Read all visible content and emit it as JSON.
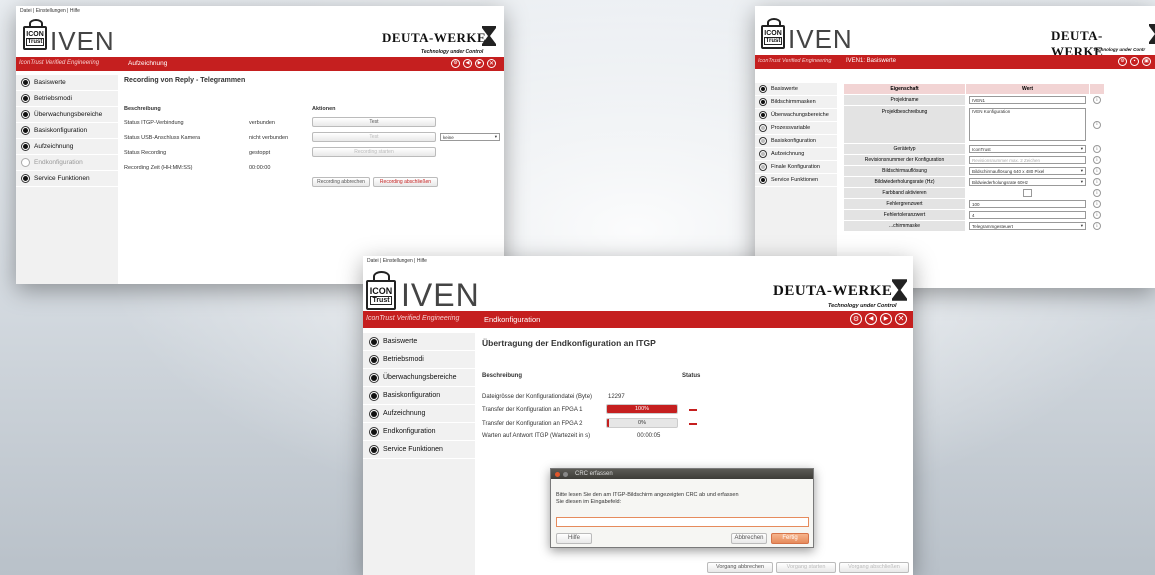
{
  "left_window": {
    "menubar": "Datei | Einstellungen | Hilfe",
    "logo_icon": "ICON",
    "logo_trust": "Trust",
    "logo_iven": "IVEN",
    "brand": "DEUTA-WERKE",
    "brand_tag": "Technology under Control",
    "tagline": "IconTrust Verified Engineering",
    "page_title": "Aufzeichnung",
    "sidebar": [
      "Basiswerte",
      "Betriebsmodi",
      "Überwachungsbereiche",
      "Basiskonfiguration",
      "Aufzeichnung",
      "Endkonfiguration",
      "Service Funktionen"
    ],
    "heading": "Recording von Reply - Telegrammen",
    "col_desc": "Beschreibung",
    "col_actions": "Aktionen",
    "rows": [
      {
        "label": "Status ITGP-Verbindung",
        "value": "verbunden",
        "action": "Test"
      },
      {
        "label": "Status USB-Anschluss Kamera",
        "value": "nicht verbunden",
        "action": "Test",
        "select": "keine"
      },
      {
        "label": "Status Recording",
        "value": "gestoppt",
        "action": "Recording starten"
      },
      {
        "label": "Recording Zeit (HH:MM:SS)",
        "value": "00:00:00",
        "action": ""
      }
    ],
    "btn_abort": "Recording abbrechen",
    "btn_finish": "Recording abschließen"
  },
  "right_window": {
    "logo_icon": "ICON",
    "logo_trust": "Trust",
    "logo_iven": "IVEN",
    "brand": "DEUTA-WERKE",
    "brand_tag": "Technology under Contr",
    "tagline": "IconTrust Verified Engineering",
    "page_title": "IVEN1: Basiswerte",
    "sidebar": [
      "Basiswerte",
      "Bildschirmmasken",
      "Überwachungsbereiche",
      "Prozessvariable",
      "Basiskonfiguration",
      "Aufzeichnung",
      "Finale Konfiguration",
      "Service Funktionen"
    ],
    "col_prop": "Eigenschaft",
    "col_val": "Wert",
    "rows": [
      {
        "prop": "Projektname",
        "value": "IVEN1"
      },
      {
        "prop": "Projektbeschreibung",
        "value": "IVEN Konfiguration"
      },
      {
        "prop": "Gerätetyp",
        "value": "IconTrust"
      },
      {
        "prop": "Revisionsnummer der Konfiguration",
        "value": "Revisionsnummer max. 2 Zeichen"
      },
      {
        "prop": "Bildschirmauflösung",
        "value": "Bildschirmauflösung 640 x 480 Pixel"
      },
      {
        "prop": "Bildwiederholungsrate (Hz)",
        "value": "Bildwiederholungsrate 60Hz"
      },
      {
        "prop": "Farbband aktivieren",
        "value": ""
      },
      {
        "prop": "Fehlergrenzwert",
        "value": "100"
      },
      {
        "prop": "Fehlertoleranzwert",
        "value": "4"
      },
      {
        "prop": "...chirmmaske",
        "value": "Telegrammgesteuert"
      }
    ]
  },
  "front_window": {
    "menubar": "Datei | Einstellungen | Hilfe",
    "logo_icon": "ICON",
    "logo_trust": "Trust",
    "logo_iven": "IVEN",
    "brand": "DEUTA-WERKE",
    "brand_tag": "Technology under Control",
    "tagline": "IconTrust Verified Engineering",
    "page_title": "Endkonfiguration",
    "sidebar": [
      "Basiswerte",
      "Betriebsmodi",
      "Überwachungsbereiche",
      "Basiskonfiguration",
      "Aufzeichnung",
      "Endkonfiguration",
      "Service Funktionen"
    ],
    "heading": "Übertragung der Endkonfiguration an ITGP",
    "col_desc": "Beschreibung",
    "col_status": "Status",
    "rows": [
      {
        "label": "Dateigrösse der Konfigurationdatei (Byte)",
        "value": "12297"
      },
      {
        "label": "Transfer der Konfiguration an FPGA 1",
        "progress_text": "100%",
        "progress": 1.0
      },
      {
        "label": "Transfer der Konfiguration an FPGA 2",
        "progress_text": "0%",
        "progress": 0.0
      },
      {
        "label": "Warten auf Antwort ITGP (Wartezeit in s)",
        "value": "00:00:05"
      }
    ],
    "btn_abort": "Vorgang abbrechen",
    "btn_start": "Vorgang starten",
    "btn_finish": "Vorgang abschließen",
    "dialog": {
      "title": "CRC erfassen",
      "text": "Bitte lesen Sie den am ITGP-Bildschirm angezeigten CRC ab und erfassen Sie diesen im Eingabefeld:",
      "input_value": "",
      "btn_help": "Hilfe",
      "btn_cancel": "Abbrechen",
      "btn_done": "Fertig"
    }
  },
  "colors": {
    "accent": "#c51f1f",
    "sidebar": "#f1f1f1",
    "header_pink": "#f2d4d4"
  }
}
